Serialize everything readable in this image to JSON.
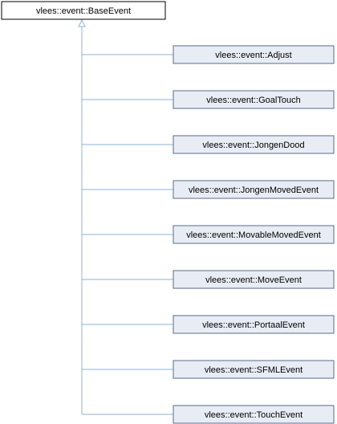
{
  "base_class": {
    "label": "vlees::event::BaseEvent"
  },
  "derived_classes": [
    {
      "label": "vlees::event::Adjust"
    },
    {
      "label": "vlees::event::GoalTouch"
    },
    {
      "label": "vlees::event::JongenDood"
    },
    {
      "label": "vlees::event::JongenMovedEvent"
    },
    {
      "label": "vlees::event::MovableMovedEvent"
    },
    {
      "label": "vlees::event::MoveEvent"
    },
    {
      "label": "vlees::event::PortaalEvent"
    },
    {
      "label": "vlees::event::SFMLEvent"
    },
    {
      "label": "vlees::event::TouchEvent"
    }
  ],
  "colors": {
    "base_fill": "#ffffff",
    "base_border": "#000000",
    "derived_fill": "#e8edf5",
    "derived_border": "#5a6a8a",
    "edge": "#8fb3d9"
  }
}
